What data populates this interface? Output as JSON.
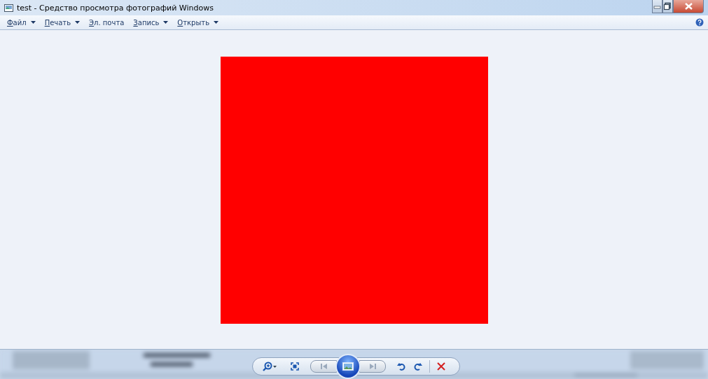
{
  "window": {
    "title": "test - Средство просмотра фотографий Windows",
    "controls": [
      {
        "kind": "minimize"
      },
      {
        "kind": "maximize"
      },
      {
        "kind": "close"
      }
    ]
  },
  "menu": [
    {
      "label": "Файл",
      "dropdown": true
    },
    {
      "label": "Печать",
      "dropdown": true
    },
    {
      "label": "Эл. почта",
      "dropdown": false
    },
    {
      "label": "Запись",
      "dropdown": true
    },
    {
      "label": "Открыть",
      "dropdown": true
    }
  ],
  "toolbar": [
    {
      "kind": "zoom",
      "disabled": false
    },
    {
      "kind": "fit",
      "disabled": false
    },
    {
      "kind": "previous",
      "disabled": true
    },
    {
      "kind": "slideshow",
      "disabled": false
    },
    {
      "kind": "next",
      "disabled": true
    },
    {
      "kind": "rotate-left",
      "disabled": false
    },
    {
      "kind": "rotate-right",
      "disabled": false
    },
    {
      "kind": "delete",
      "disabled": false
    }
  ]
}
